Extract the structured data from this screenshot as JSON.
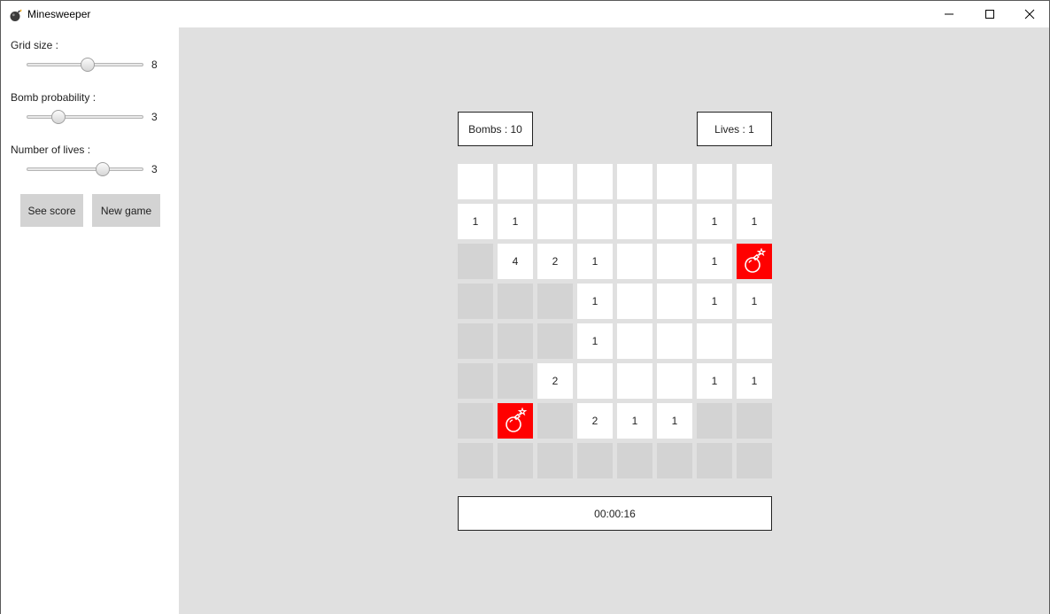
{
  "window": {
    "title": "Minesweeper",
    "app_icon": "bomb-icon",
    "controls": [
      "minimize-icon",
      "maximize-icon",
      "close-icon"
    ]
  },
  "sidebar": {
    "grid_size": {
      "label": "Grid size :",
      "value": "8",
      "fraction": 0.52
    },
    "bomb_probability": {
      "label": "Bomb probability :",
      "value": "3",
      "fraction": 0.27
    },
    "number_of_lives": {
      "label": "Number of lives :",
      "value": "3",
      "fraction": 0.65
    },
    "see_score_label": "See score",
    "new_game_label": "New game"
  },
  "game": {
    "bombs_text": "Bombs : 10",
    "lives_text": "Lives : 1",
    "timer": "00:00:16",
    "board": [
      [
        "r",
        "r",
        "r",
        "r",
        "r",
        "r",
        "r",
        "r"
      ],
      [
        "1",
        "1",
        "r",
        "r",
        "r",
        "r",
        "1",
        "1"
      ],
      [
        "h",
        "4",
        "2",
        "1",
        "r",
        "r",
        "1",
        "B"
      ],
      [
        "h",
        "h",
        "h",
        "1",
        "r",
        "r",
        "1",
        "1"
      ],
      [
        "h",
        "h",
        "h",
        "1",
        "r",
        "r",
        "r",
        "r"
      ],
      [
        "h",
        "h",
        "2",
        "r",
        "r",
        "r",
        "1",
        "1"
      ],
      [
        "h",
        "B",
        "h",
        "2",
        "1",
        "1",
        "h",
        "h"
      ],
      [
        "h",
        "h",
        "h",
        "h",
        "h",
        "h",
        "h",
        "h"
      ]
    ],
    "colors": {
      "revealed": "#ffffff",
      "hidden": "#d3d3d3",
      "bomb": "#ff0000",
      "background": "#e0e0e0"
    }
  }
}
